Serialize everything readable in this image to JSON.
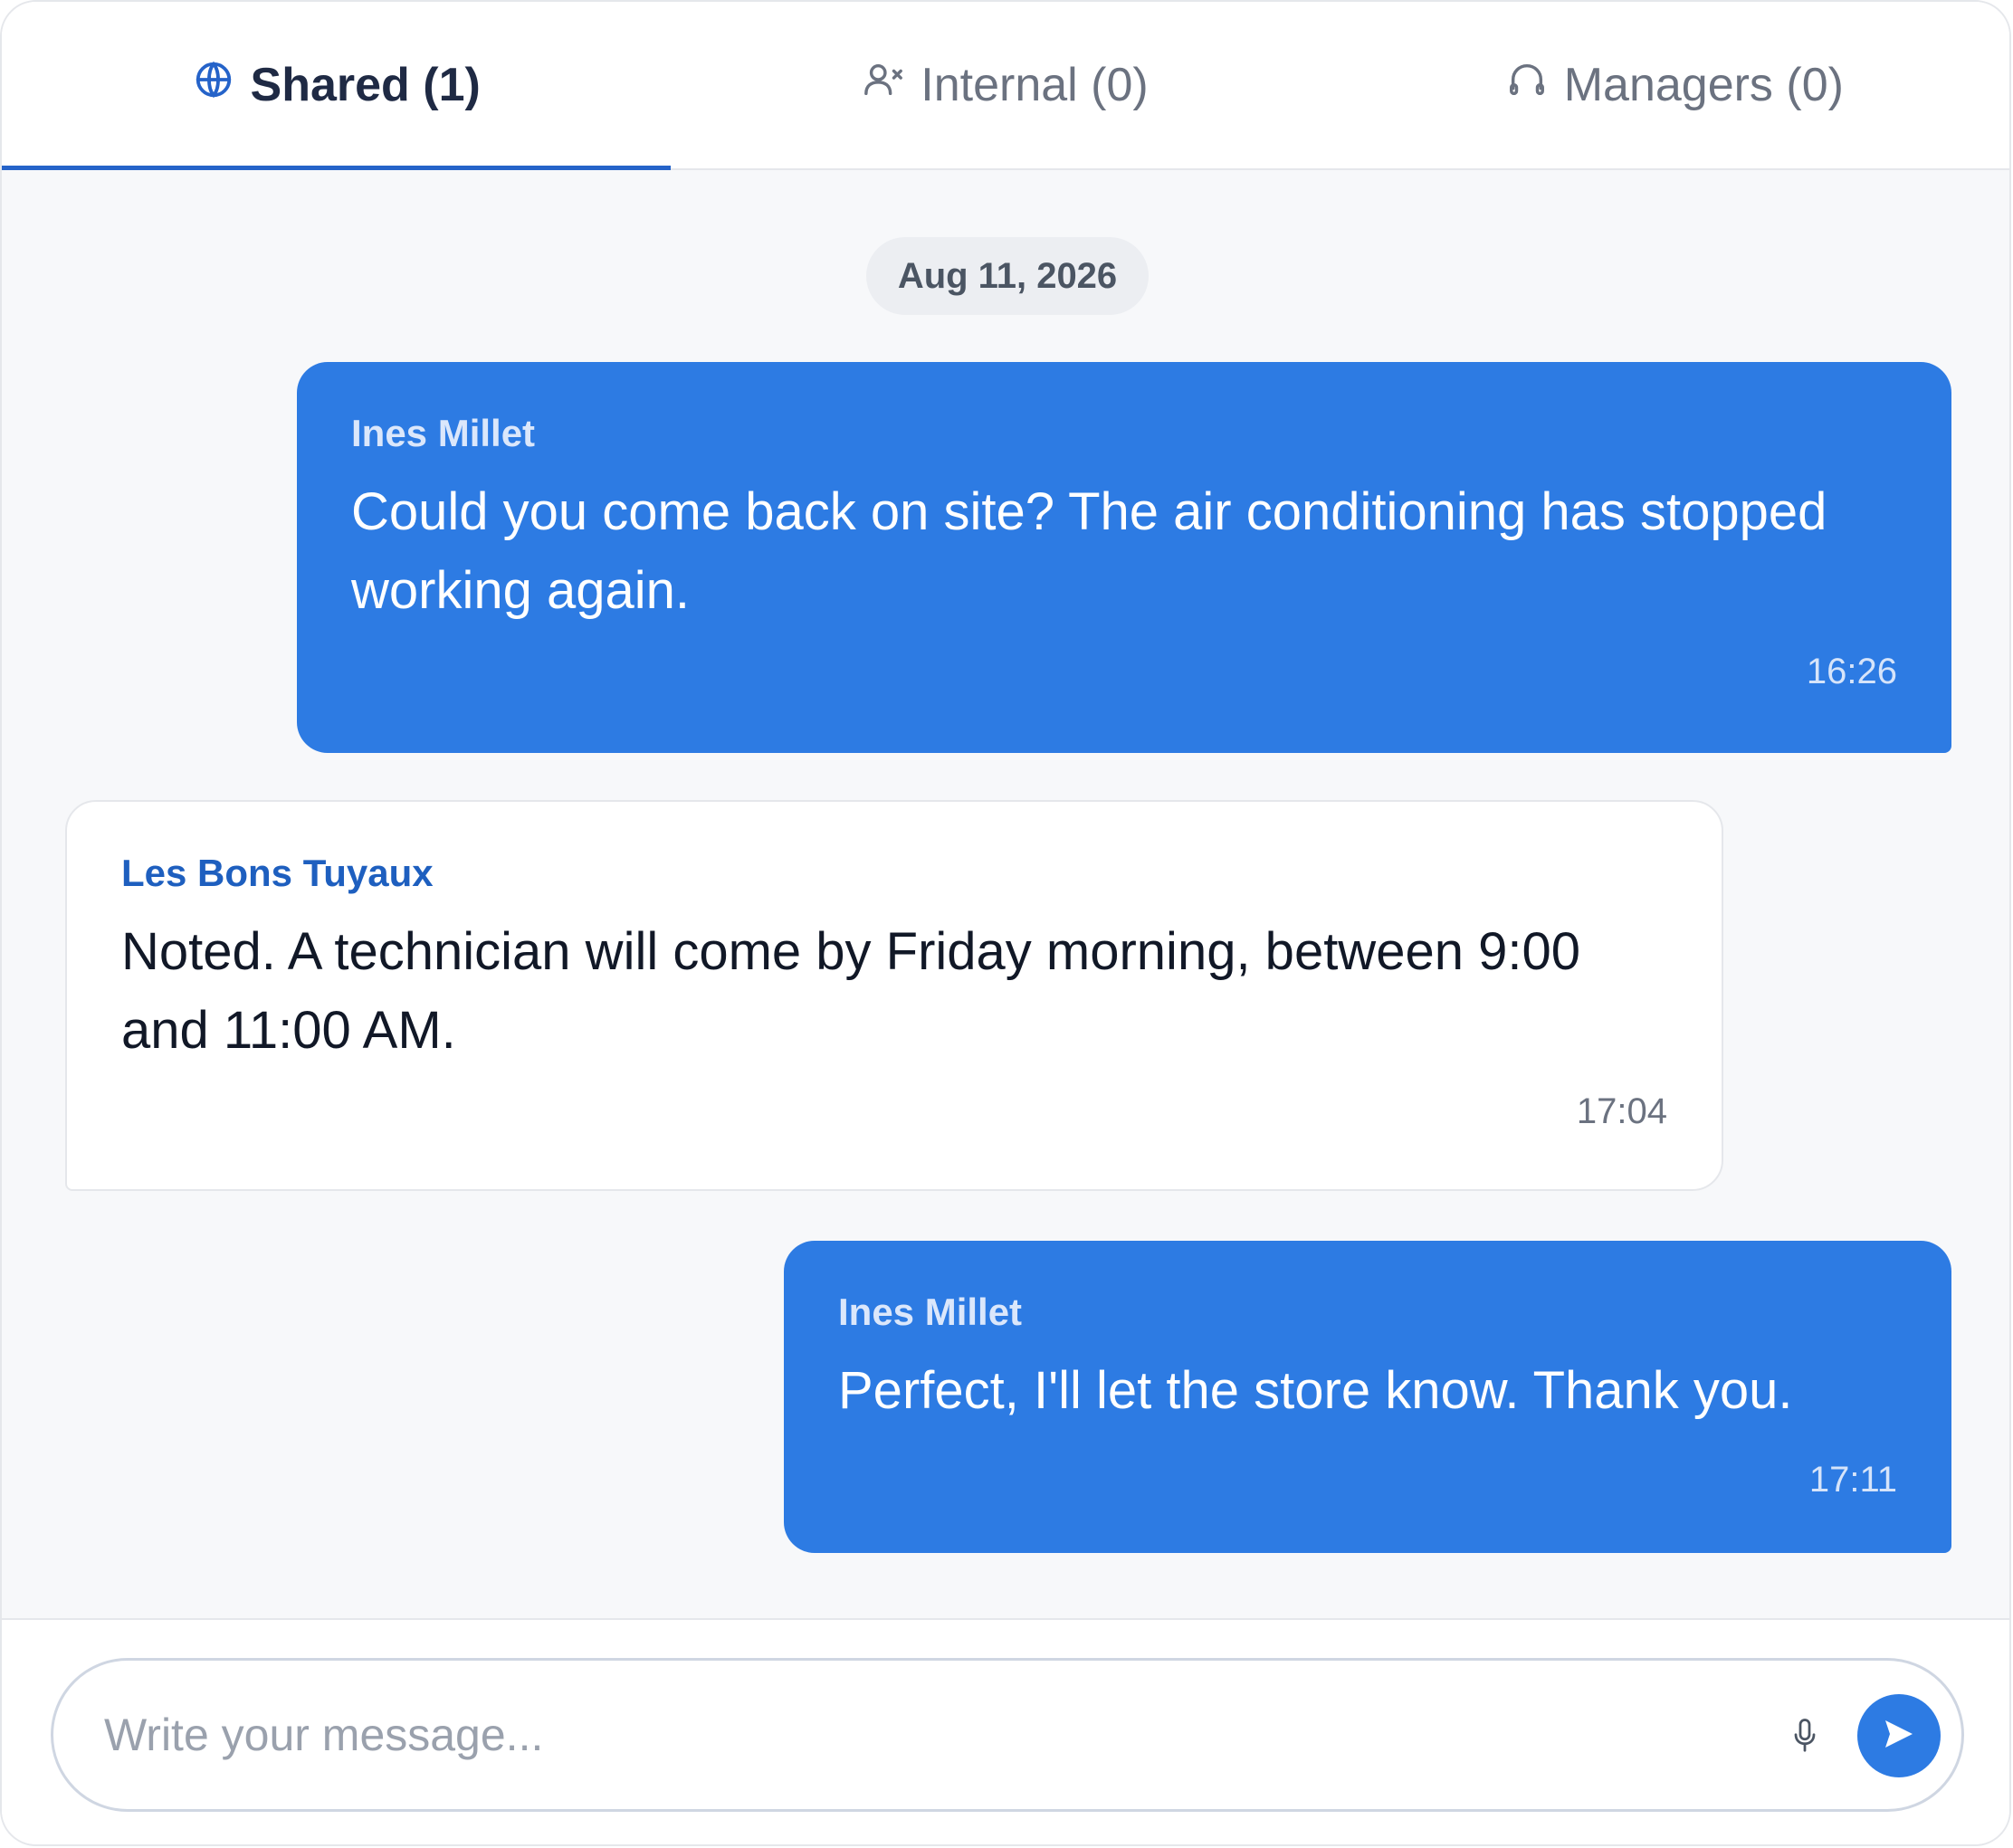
{
  "tabs": [
    {
      "label": "Shared (1)",
      "icon": "globe-icon",
      "active": true
    },
    {
      "label": "Internal (0)",
      "icon": "user-x-icon",
      "active": false
    },
    {
      "label": "Managers (0)",
      "icon": "headphones-icon",
      "active": false
    }
  ],
  "chat": {
    "date": "Aug 11, 2026",
    "messages": [
      {
        "sender": "Ines Millet",
        "text": "Could you come back on site? The air conditioning has stopped working again.",
        "time": "16:26",
        "direction": "outgoing"
      },
      {
        "sender": "Les Bons Tuyaux",
        "text": "Noted. A technician will come by Friday morning, between 9:00 and 11:00 AM.",
        "time": "17:04",
        "direction": "incoming"
      },
      {
        "sender": "Ines Millet",
        "text": "Perfect, I'll let the store know. Thank you.",
        "time": "17:11",
        "direction": "outgoing"
      }
    ]
  },
  "composer": {
    "placeholder": "Write your message...",
    "value": "",
    "mic_icon": "microphone-icon",
    "send_icon": "send-icon"
  },
  "colors": {
    "accent": "#2d7be3",
    "active_tab_underline": "#2563c9",
    "incoming_sender": "#1e5fbf",
    "chat_background": "#f7f8fa"
  }
}
